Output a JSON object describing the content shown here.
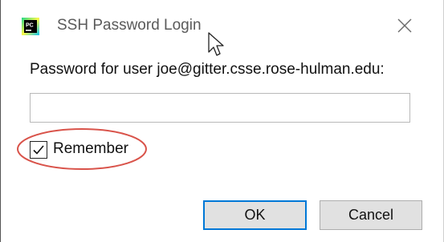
{
  "window": {
    "title": "SSH Password Login",
    "app_icon": "pycharm-icon",
    "app_icon_text": "PC",
    "close_icon": "close-icon"
  },
  "form": {
    "prompt_label": "Password for user joe@gitter.csse.rose-hulman.edu:",
    "password_value": "",
    "remember_label": "Remember",
    "remember_checked": true
  },
  "buttons": {
    "ok_label": "OK",
    "cancel_label": "Cancel"
  },
  "colors": {
    "annotation_ring": "#d9534a",
    "focus_border": "#0078d7",
    "button_face": "#e1e1e1"
  }
}
